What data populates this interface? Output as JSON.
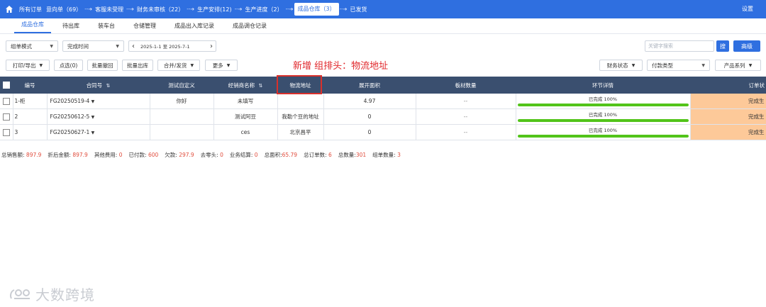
{
  "nav": {
    "crumbs": [
      {
        "label": "所有订单",
        "active": false
      },
      {
        "label": "意向单（69）",
        "active": false
      },
      {
        "label": "客服未受理",
        "active": false
      },
      {
        "label": "财务未审核（22）",
        "active": false
      },
      {
        "label": "生产安排(12)",
        "active": false
      },
      {
        "label": "生产进度（2）",
        "active": false
      },
      {
        "label": "成品仓库（3）",
        "active": true
      },
      {
        "label": "已发货",
        "active": false
      }
    ],
    "settings_label": "设置"
  },
  "tabs": [
    {
      "label": "成品仓库",
      "active": true
    },
    {
      "label": "待出库",
      "active": false
    },
    {
      "label": "装车台",
      "active": false
    },
    {
      "label": "仓储管理",
      "active": false
    },
    {
      "label": "成品出入库记录",
      "active": false
    },
    {
      "label": "成品调仓记录",
      "active": false
    }
  ],
  "filters": {
    "mode_select": "组单模式",
    "time_select": "完成时间",
    "date_range": "2025-1-1 至 2025-7-1",
    "prev_symbol": "‹",
    "next_symbol": "›",
    "search_placeholder": "关键字搜索",
    "search_button": "搜",
    "advanced_button": "高级"
  },
  "actions": {
    "print_export": "打印/导出",
    "select": "点选(0)",
    "batch_recall": "批量撤回",
    "batch_out": "批量出库",
    "merge_ship": "合并/发货",
    "more": "更多",
    "finance_status": "财务状态",
    "payment_type": "付款类型",
    "product_series": "产品系列"
  },
  "annotation": "新增 组排头：物流地址",
  "table": {
    "headers": {
      "number": "编号",
      "contract": "合同号",
      "custom": "测试自定义",
      "dealer": "经销商名称",
      "logistics": "物流地址",
      "area": "展开面积",
      "board": "板材数量",
      "progress": "环节详情",
      "status": "订单状"
    },
    "rows": [
      {
        "number": "1-柜",
        "contract": "FG20250519-4",
        "custom": "你好",
        "dealer": "未填写",
        "logistics": "",
        "area": "4.97",
        "board": "--",
        "progress_text": "已完成 100%",
        "progress": 1.0,
        "status": "完成生"
      },
      {
        "number": "2",
        "contract": "FG20250612-5",
        "custom": "",
        "dealer": "测试阿豆",
        "logistics": "我勒个豆的地址",
        "area": "0",
        "board": "--",
        "progress_text": "已完成 100%",
        "progress": 1.0,
        "status": "完成生"
      },
      {
        "number": "3",
        "contract": "FG20250627-1",
        "custom": "",
        "dealer": "ces",
        "logistics": "北京昌平",
        "area": "0",
        "board": "--",
        "progress_text": "已完成 100%",
        "progress": 1.0,
        "status": "完成生"
      }
    ]
  },
  "summary": [
    {
      "label": "总销售额:",
      "value": "897.9"
    },
    {
      "label": "折后金额:",
      "value": "897.9"
    },
    {
      "label": "其他费用:",
      "value": "0"
    },
    {
      "label": "已付款:",
      "value": "600"
    },
    {
      "label": "欠款:",
      "value": "297.9"
    },
    {
      "label": "去零头:",
      "value": "0"
    },
    {
      "label": "业务结算:",
      "value": "0"
    },
    {
      "label": "总面积:",
      "value": "65.79"
    },
    {
      "label": "总订单数:",
      "value": "6"
    },
    {
      "label": "总数量:",
      "value": "301"
    },
    {
      "label": "组单数量:",
      "value": "3"
    }
  ],
  "watermark": "大数跨境",
  "colors": {
    "primary": "#2f6fe0",
    "header": "#3a4f6f",
    "progress": "#52c41a",
    "status": "#fdc999",
    "annotation": "#e0262a"
  }
}
